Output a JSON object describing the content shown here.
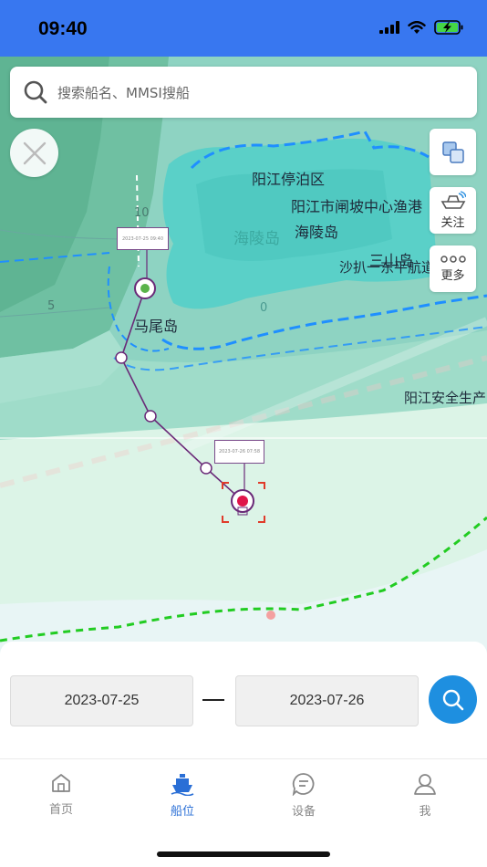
{
  "status_bar": {
    "time": "09:40"
  },
  "search": {
    "placeholder": "搜索船名、MMSI搜船"
  },
  "side_buttons": {
    "follow_label": "关注",
    "more_label": "更多"
  },
  "map": {
    "place_labels": {
      "yangjiang_anchorage": "阳江停泊区",
      "yangjiang_zhapo_fishing_port": "阳江市闸坡中心渔港",
      "hailing_island": "海陵岛",
      "hailing_island_watermark": "海陵岛",
      "sanshan_island": "三山岛",
      "shapa_waterway": "沙扒一东平航道",
      "mawei_island": "马尾岛",
      "yangjiang_safety": "阳江安全生产"
    },
    "depth_labels": {
      "d10": "10",
      "d5": "5",
      "d0": "0"
    },
    "track_labels": {
      "start_time": "2023-07-25 09:40",
      "end_time": "2023-07-26 07:58"
    },
    "colors": {
      "track": "#6a2a78",
      "start_marker": "#5ab34a",
      "end_marker": "#e0154a",
      "boundary": "#1f8fff",
      "green_line": "#22cc22"
    }
  },
  "date_range": {
    "start": "2023-07-25",
    "end": "2023-07-26"
  },
  "tabs": [
    {
      "label": "首页",
      "icon": "home-icon"
    },
    {
      "label": "船位",
      "icon": "ship-icon",
      "active": true
    },
    {
      "label": "设备",
      "icon": "chat-icon"
    },
    {
      "label": "我",
      "icon": "user-icon"
    }
  ]
}
